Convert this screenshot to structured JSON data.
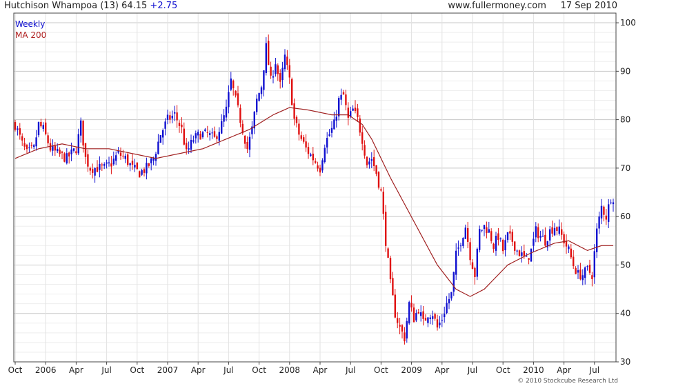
{
  "header": {
    "security": "Hutchison Whampoa (13)",
    "price": "64.15",
    "change": "+2.75",
    "site": "www.fullermoney.com",
    "date": "17 Sep 2010"
  },
  "legend": {
    "weekly": "Weekly",
    "ma": "MA 200"
  },
  "copyright": "© 2010 Stockcube Research Ltd",
  "colors": {
    "up": "#1010d0",
    "down": "#e01010",
    "ma": "#a02020",
    "grid": "#d8d8d8",
    "axis": "#444444"
  },
  "chart_data": {
    "type": "candlestick",
    "ylim": [
      30,
      102
    ],
    "y_ticks": [
      30,
      40,
      50,
      60,
      70,
      80,
      90,
      100
    ],
    "x_ticks": [
      {
        "label": "Oct",
        "w": 0
      },
      {
        "label": "2006",
        "w": 13
      },
      {
        "label": "Apr",
        "w": 26
      },
      {
        "label": "Jul",
        "w": 39
      },
      {
        "label": "Oct",
        "w": 52
      },
      {
        "label": "2007",
        "w": 65
      },
      {
        "label": "Apr",
        "w": 78
      },
      {
        "label": "Jul",
        "w": 91
      },
      {
        "label": "Oct",
        "w": 104
      },
      {
        "label": "2008",
        "w": 117
      },
      {
        "label": "Apr",
        "w": 130
      },
      {
        "label": "Jul",
        "w": 143
      },
      {
        "label": "Oct",
        "w": 156
      },
      {
        "label": "2009",
        "w": 169
      },
      {
        "label": "Apr",
        "w": 182
      },
      {
        "label": "Jul",
        "w": 195
      },
      {
        "label": "Oct",
        "w": 208
      },
      {
        "label": "2010",
        "w": 221
      },
      {
        "label": "Apr",
        "w": 234
      },
      {
        "label": "Jul",
        "w": 247
      }
    ],
    "price_anchors": [
      [
        0,
        79
      ],
      [
        3,
        75
      ],
      [
        5,
        73
      ],
      [
        8,
        74
      ],
      [
        10,
        79
      ],
      [
        12,
        78
      ],
      [
        15,
        74
      ],
      [
        18,
        73
      ],
      [
        22,
        72
      ],
      [
        26,
        74
      ],
      [
        28,
        79
      ],
      [
        30,
        72
      ],
      [
        32,
        70
      ],
      [
        35,
        70
      ],
      [
        38,
        70
      ],
      [
        41,
        71
      ],
      [
        44,
        73
      ],
      [
        47,
        72
      ],
      [
        50,
        70
      ],
      [
        53,
        69
      ],
      [
        56,
        70
      ],
      [
        59,
        72
      ],
      [
        62,
        77
      ],
      [
        65,
        80
      ],
      [
        68,
        81
      ],
      [
        71,
        78
      ],
      [
        73,
        73
      ],
      [
        76,
        76
      ],
      [
        79,
        77
      ],
      [
        82,
        77
      ],
      [
        85,
        76
      ],
      [
        88,
        79
      ],
      [
        90,
        82
      ],
      [
        92,
        88
      ],
      [
        95,
        82
      ],
      [
        97,
        78
      ],
      [
        99,
        74
      ],
      [
        101,
        78
      ],
      [
        103,
        84
      ],
      [
        105,
        87
      ],
      [
        107,
        95
      ],
      [
        109,
        88
      ],
      [
        111,
        92
      ],
      [
        113,
        87
      ],
      [
        115,
        93
      ],
      [
        117,
        88
      ],
      [
        119,
        80
      ],
      [
        121,
        77
      ],
      [
        124,
        74
      ],
      [
        127,
        72
      ],
      [
        130,
        70
      ],
      [
        132,
        75
      ],
      [
        134,
        77
      ],
      [
        136,
        79
      ],
      [
        138,
        84
      ],
      [
        140,
        85
      ],
      [
        142,
        80
      ],
      [
        144,
        82
      ],
      [
        146,
        80
      ],
      [
        148,
        76
      ],
      [
        150,
        71
      ],
      [
        152,
        72
      ],
      [
        154,
        69
      ],
      [
        156,
        65
      ],
      [
        158,
        55
      ],
      [
        160,
        46
      ],
      [
        162,
        40
      ],
      [
        164,
        37
      ],
      [
        166,
        35
      ],
      [
        168,
        42
      ],
      [
        170,
        39
      ],
      [
        172,
        41
      ],
      [
        174,
        38
      ],
      [
        176,
        40
      ],
      [
        178,
        40
      ],
      [
        180,
        37
      ],
      [
        182,
        39
      ],
      [
        184,
        42
      ],
      [
        186,
        44
      ],
      [
        188,
        52
      ],
      [
        190,
        55
      ],
      [
        192,
        58
      ],
      [
        194,
        52
      ],
      [
        196,
        48
      ],
      [
        198,
        57
      ],
      [
        200,
        58
      ],
      [
        202,
        57
      ],
      [
        204,
        54
      ],
      [
        206,
        56
      ],
      [
        208,
        53
      ],
      [
        210,
        56
      ],
      [
        212,
        55
      ],
      [
        214,
        53
      ],
      [
        216,
        52
      ],
      [
        218,
        51
      ],
      [
        220,
        53
      ],
      [
        222,
        57
      ],
      [
        224,
        56
      ],
      [
        226,
        55
      ],
      [
        228,
        57
      ],
      [
        230,
        58
      ],
      [
        232,
        57
      ],
      [
        234,
        55
      ],
      [
        236,
        53
      ],
      [
        238,
        50
      ],
      [
        240,
        48
      ],
      [
        242,
        48
      ],
      [
        244,
        49
      ],
      [
        246,
        48
      ],
      [
        248,
        57
      ],
      [
        250,
        62
      ],
      [
        252,
        60
      ],
      [
        254,
        64
      ]
    ],
    "ma_anchors": [
      [
        0,
        72
      ],
      [
        10,
        74
      ],
      [
        20,
        75
      ],
      [
        30,
        74
      ],
      [
        40,
        74
      ],
      [
        50,
        73
      ],
      [
        60,
        72
      ],
      [
        70,
        73
      ],
      [
        80,
        74
      ],
      [
        90,
        76
      ],
      [
        100,
        78
      ],
      [
        110,
        81
      ],
      [
        117,
        82.5
      ],
      [
        125,
        82
      ],
      [
        135,
        81
      ],
      [
        142,
        81
      ],
      [
        148,
        79
      ],
      [
        152,
        76
      ],
      [
        160,
        68
      ],
      [
        170,
        59
      ],
      [
        180,
        50
      ],
      [
        188,
        45
      ],
      [
        194,
        43.5
      ],
      [
        200,
        45
      ],
      [
        210,
        50
      ],
      [
        220,
        52.5
      ],
      [
        230,
        54.5
      ],
      [
        236,
        55
      ],
      [
        244,
        53
      ],
      [
        250,
        54
      ]
    ]
  }
}
